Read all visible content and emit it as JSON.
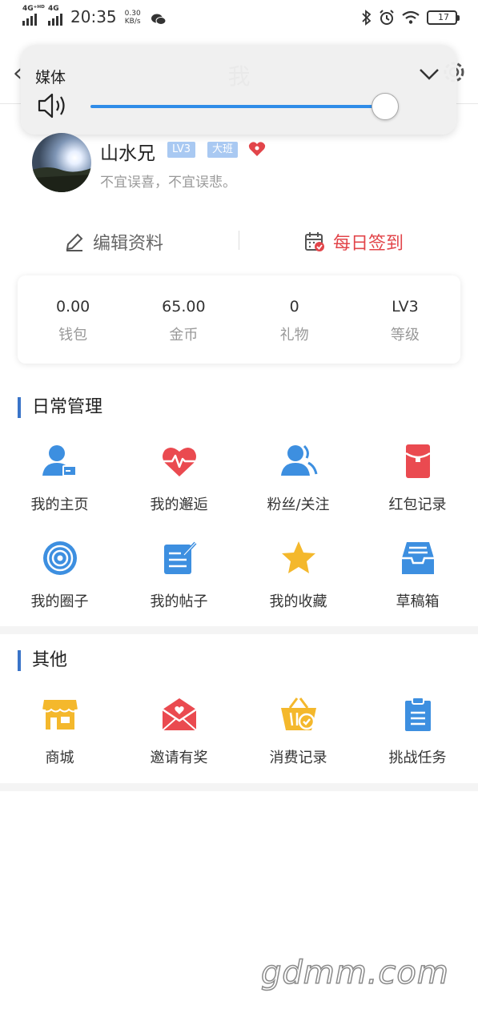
{
  "status_bar": {
    "net1": "4G⁺ᴴᴰ",
    "net2": "4G",
    "time": "20:35",
    "speed_value": "0.30",
    "speed_unit": "KB/s",
    "battery": "17"
  },
  "navbar": {
    "title": "我"
  },
  "media_panel": {
    "title": "媒体",
    "volume_fraction": 0.95,
    "accent": "#2f8ce8"
  },
  "profile": {
    "name": "山水兄",
    "level_badge": "LV3",
    "class_badge": "大班",
    "motto": "不宜误喜，不宜误悲。"
  },
  "actions": {
    "edit": "编辑资料",
    "sign_in": "每日签到",
    "sign_color": "#e2454a"
  },
  "stats": [
    {
      "value": "0.00",
      "label": "钱包"
    },
    {
      "value": "65.00",
      "label": "金币"
    },
    {
      "value": "0",
      "label": "礼物"
    },
    {
      "value": "LV3",
      "label": "等级"
    }
  ],
  "daily": {
    "title": "日常管理",
    "items": [
      {
        "label": "我的主页",
        "icon": "user-home-icon"
      },
      {
        "label": "我的邂逅",
        "icon": "heartbeat-icon"
      },
      {
        "label": "粉丝/关注",
        "icon": "fans-icon"
      },
      {
        "label": "红包记录",
        "icon": "red-envelope-icon"
      },
      {
        "label": "我的圈子",
        "icon": "circle-target-icon"
      },
      {
        "label": "我的帖子",
        "icon": "post-edit-icon"
      },
      {
        "label": "我的收藏",
        "icon": "star-icon"
      },
      {
        "label": "草稿箱",
        "icon": "draft-box-icon"
      }
    ]
  },
  "other": {
    "title": "其他",
    "items": [
      {
        "label": "商城",
        "icon": "shop-icon"
      },
      {
        "label": "邀请有奖",
        "icon": "invite-envelope-icon"
      },
      {
        "label": "消费记录",
        "icon": "basket-icon"
      },
      {
        "label": "挑战任务",
        "icon": "clipboard-icon"
      }
    ]
  },
  "watermark": "gdmm.com"
}
